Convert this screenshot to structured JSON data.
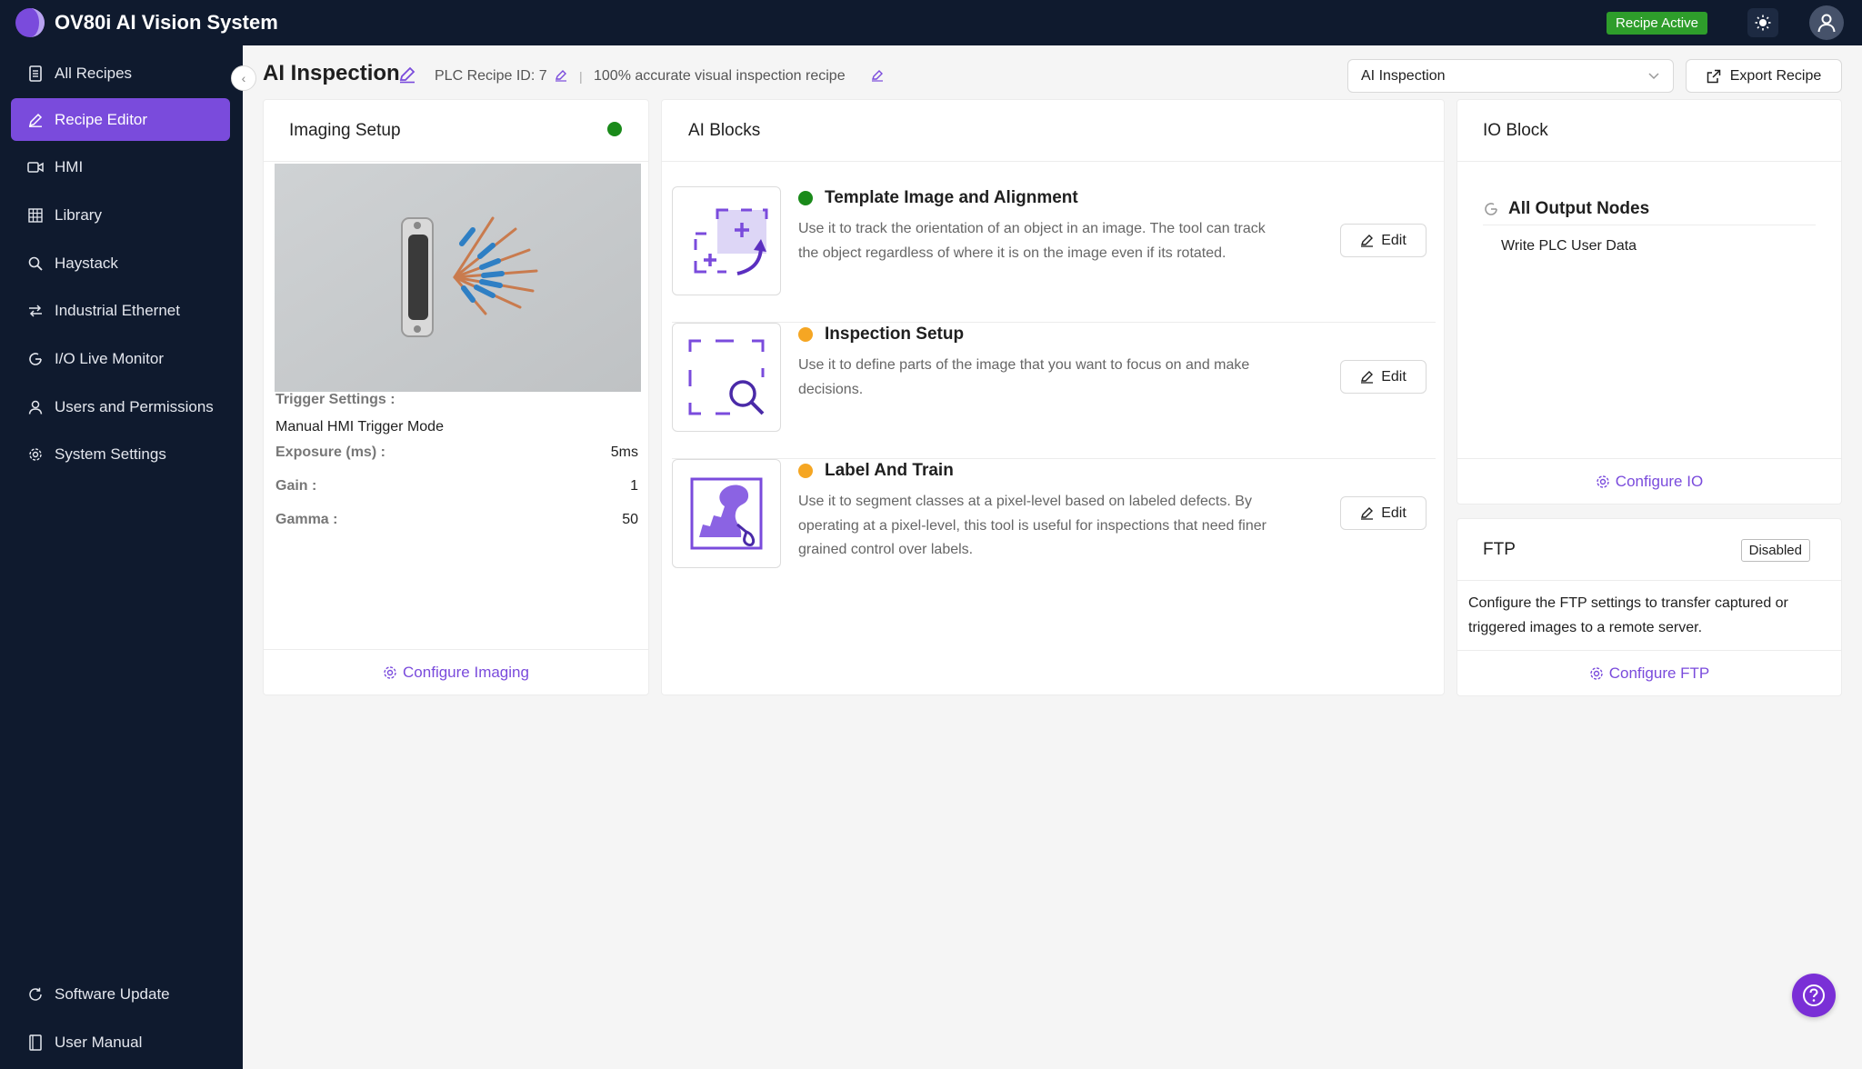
{
  "app": {
    "title": "OV80i AI Vision System",
    "status_badge": "Recipe Active"
  },
  "sidebar": {
    "items": [
      {
        "label": "All Recipes",
        "icon": "document-icon"
      },
      {
        "label": "Recipe Editor",
        "icon": "pencil-icon",
        "active": true
      },
      {
        "label": "HMI",
        "icon": "video-icon"
      },
      {
        "label": "Library",
        "icon": "table-icon"
      },
      {
        "label": "Haystack",
        "icon": "search-icon"
      },
      {
        "label": "Industrial Ethernet",
        "icon": "network-icon"
      },
      {
        "label": "I/O Live Monitor",
        "icon": "monitor-icon"
      },
      {
        "label": "Users and Permissions",
        "icon": "user-icon"
      },
      {
        "label": "System Settings",
        "icon": "gear-icon"
      }
    ],
    "bottom_items": [
      {
        "label": "Software Update",
        "icon": "refresh-icon"
      },
      {
        "label": "User Manual",
        "icon": "book-icon"
      }
    ]
  },
  "header": {
    "title": "AI Inspection",
    "plc_recipe_id": "PLC Recipe ID: 7",
    "separator": "|",
    "description": "100% accurate visual inspection recipe",
    "recipe_select": "AI Inspection",
    "export_label": "Export Recipe"
  },
  "imaging": {
    "title": "Imaging Setup",
    "status_color": "#1a8a1a",
    "trigger_label": "Trigger Settings :",
    "trigger_value": "Manual HMI Trigger Mode",
    "exposure_label": "Exposure (ms) :",
    "exposure_value": "5ms",
    "gain_label": "Gain :",
    "gain_value": "1",
    "gamma_label": "Gamma :",
    "gamma_value": "50",
    "footer": "Configure Imaging"
  },
  "ai_blocks": {
    "title": "AI Blocks",
    "blocks": [
      {
        "title": "Template Image and Alignment",
        "status_color": "#1a8a1a",
        "desc": "Use it to track the orientation of an object in an image. The tool can track the object regardless of where it is on the image even if its rotated.",
        "edit": "Edit"
      },
      {
        "title": "Inspection Setup",
        "status_color": "#f5a623",
        "desc": "Use it to define parts of the image that you want to focus on and make decisions.",
        "edit": "Edit"
      },
      {
        "title": "Label And Train",
        "status_color": "#f5a623",
        "desc": "Use it to segment classes at a pixel-level based on labeled defects. By operating at a pixel-level, this tool is useful for inspections that need finer grained control over labels.",
        "edit": "Edit"
      }
    ]
  },
  "io": {
    "title": "IO Block",
    "nodes_title": "All Output Nodes",
    "node_item": "Write PLC User Data",
    "footer": "Configure IO"
  },
  "ftp": {
    "title": "FTP",
    "status": "Disabled",
    "desc": "Configure the FTP settings to transfer captured or triggered images to a remote server.",
    "footer": "Configure FTP"
  },
  "colors": {
    "accent": "#7a4bdc",
    "sidebar_bg": "#0f1a2e",
    "success": "#2e9d2b",
    "warning": "#f5a623"
  }
}
